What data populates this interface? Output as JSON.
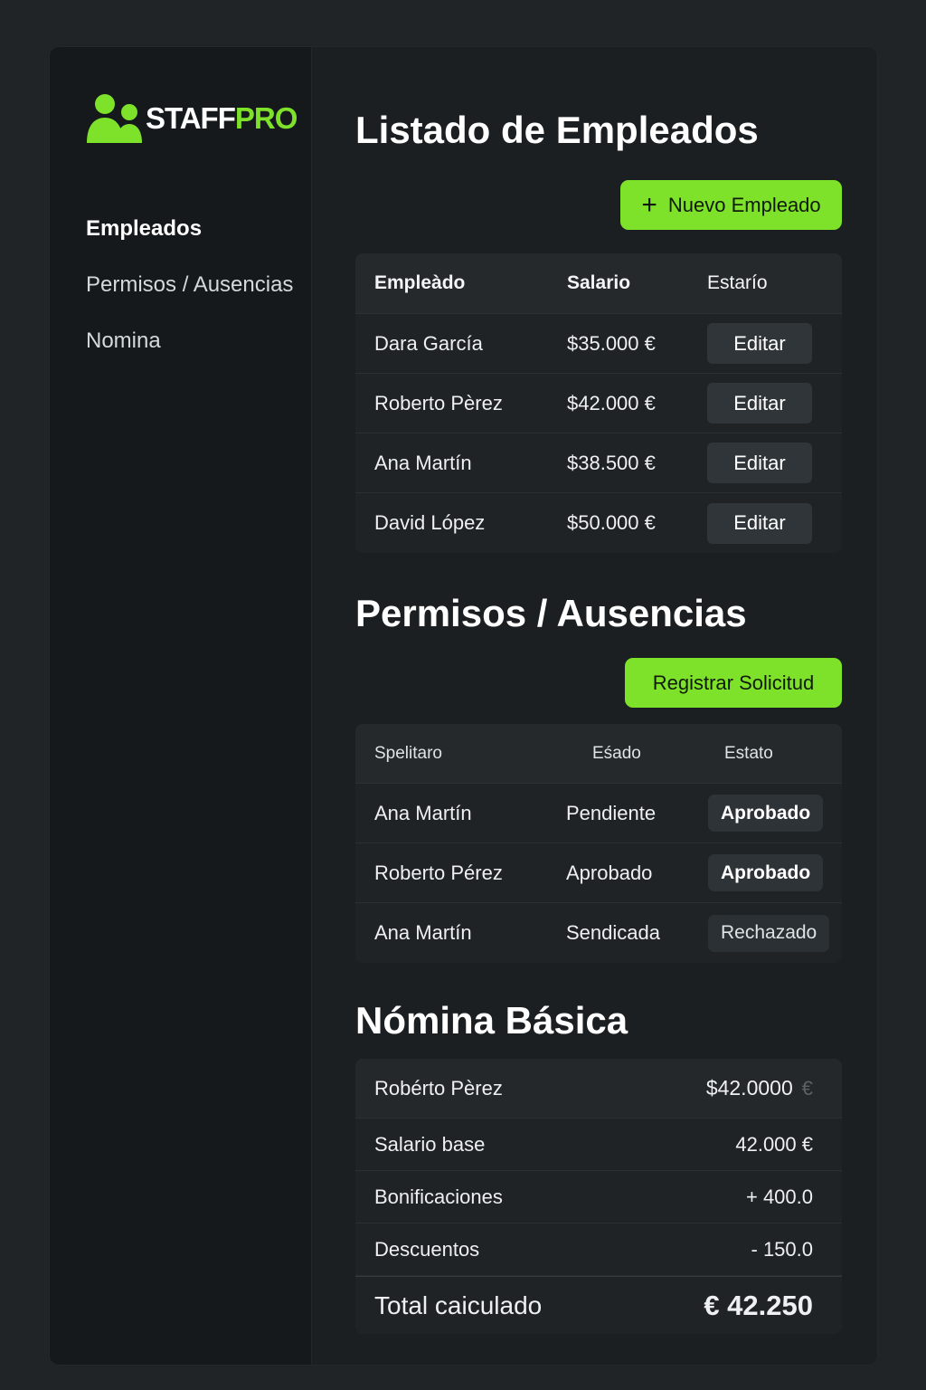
{
  "brand": {
    "name_part1": "STAFF",
    "name_part2": "PRO",
    "accent_color": "#7fe22a",
    "icon": "users-icon"
  },
  "sidebar": {
    "items": [
      {
        "label": "Empleados",
        "active": true
      },
      {
        "label": "Permisos / Ausencias",
        "active": false
      },
      {
        "label": "Nomina",
        "active": false
      }
    ]
  },
  "employees": {
    "title": "Listado de Empleados",
    "new_button_label": "Nuevo Empleado",
    "columns": [
      "Empleàdo",
      "Salario",
      "Estarío"
    ],
    "rows": [
      {
        "name": "Dara García",
        "salary": "$35.000 €",
        "action": "Editar"
      },
      {
        "name": "Roberto Pèrez",
        "salary": "$42.000 €",
        "action": "Editar"
      },
      {
        "name": "Ana Martín",
        "salary": "$38.500 €",
        "action": "Editar"
      },
      {
        "name": "David López",
        "salary": "$50.000 €",
        "action": "Editar"
      }
    ]
  },
  "leaves": {
    "title": "Permisos / Ausencias",
    "register_button_label": "Registrar Solicitud",
    "columns": [
      "Spelitaro",
      "Eśado",
      "Estato"
    ],
    "rows": [
      {
        "name": "Ana Martín",
        "state": "Pendiente",
        "status": "Aprobado"
      },
      {
        "name": "Roberto Pérez",
        "state": "Aprobado",
        "status": "Aprobado"
      },
      {
        "name": "Ana Martín",
        "state": "Sendicada",
        "status": "Rechazado"
      }
    ]
  },
  "payroll": {
    "title": "Nómina Básica",
    "employee_name": "Robérto Pèrez",
    "employee_amount": "$42.0000",
    "employee_amount_suffix": "€",
    "lines": [
      {
        "label": "Salario base",
        "value": "42.000 €"
      },
      {
        "label": "Bonificaciones",
        "value": "+ 400.0"
      },
      {
        "label": "Descuentos",
        "value": "- 150.0"
      }
    ],
    "total_label": "Total caiculado",
    "total_value": "€ 42.250"
  }
}
